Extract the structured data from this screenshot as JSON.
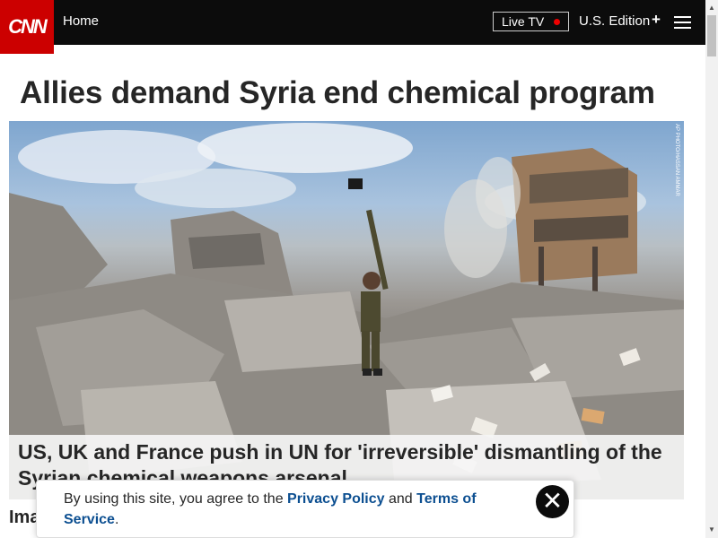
{
  "header": {
    "logo_text": "CNN",
    "home_label": "Home",
    "live_tv_label": "Live TV",
    "edition_label": "U.S. Edition",
    "edition_plus": "+",
    "menu_icon": "hamburger-icon",
    "brand_color": "#cc0000",
    "live_dot_color": "#ee0000"
  },
  "article": {
    "headline": "Allies demand Syria end chemical program",
    "hero_caption": "US, UK and France push in UN for 'irreversible' dismantling of the Syrian chemical weapons arsenal",
    "photo_credit": "AP PHOTO/HASSAN AMMAR",
    "partial_section_title": "Ima"
  },
  "cookie_banner": {
    "text_prefix": "By using this site, you agree to the ",
    "privacy_link": "Privacy Policy",
    "and_text": " and ",
    "terms_link": "Terms of Service",
    "suffix": ".",
    "close_icon": "close-icon"
  },
  "colors": {
    "header_bg": "#0c0c0c",
    "link": "#0c4f91",
    "text": "#262626"
  }
}
